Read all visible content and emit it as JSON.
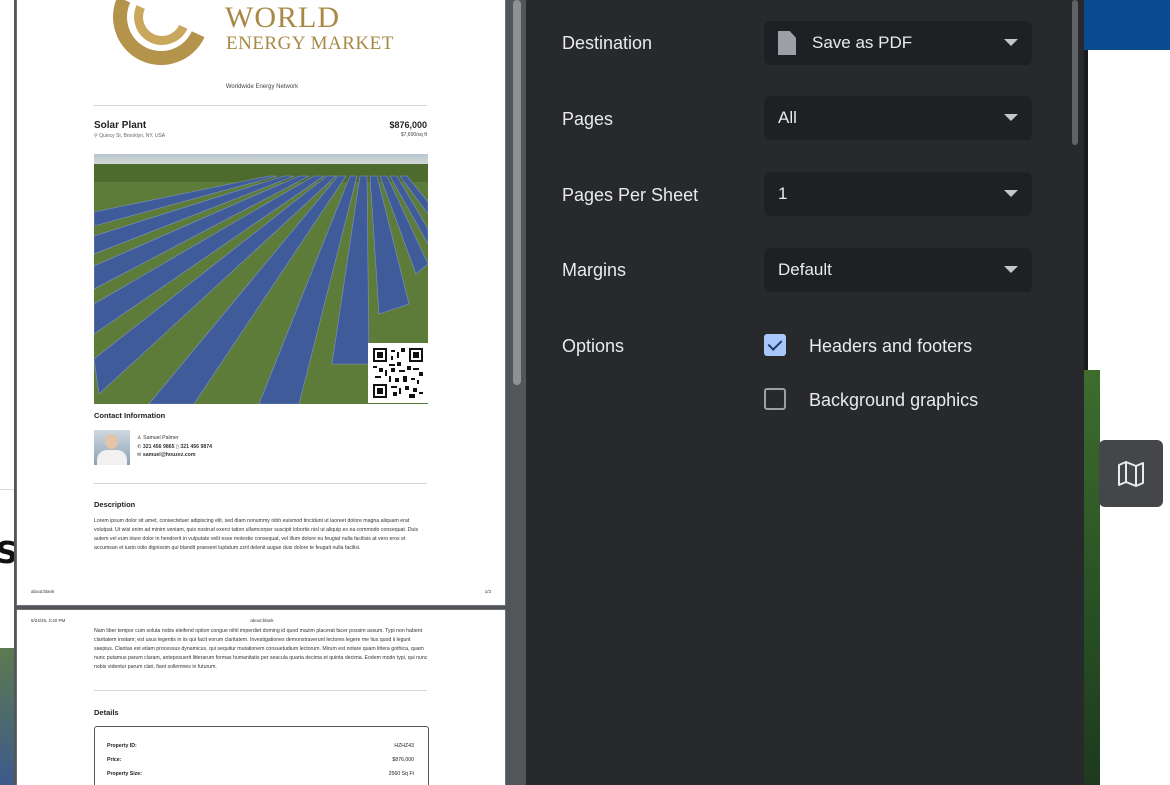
{
  "preview": {
    "page1": {
      "logo_line1": "WORLD",
      "logo_line2": "ENERGY MARKET",
      "tagline": "Worldwide Energy Network",
      "property_title": "Solar Plant",
      "property_address": "Quincy St, Brooklyn, NY, USA",
      "property_price": "$876,000",
      "property_price_per_sqft": "$7,600/sq ft",
      "contact_heading": "Contact Information",
      "agent_name": "Samuel Palmer",
      "agent_phone1": "321 456 9865",
      "agent_phone2": "321 456 9874",
      "agent_email": "samuel@houzez.com",
      "description_heading": "Description",
      "description_text": "Lorem ipsum dolor sit amet, consectetuer adipiscing elit, sed diam nonummy nibh euismod tincidunt ut laoreet dolore magna aliquam erat volutpat. Ut wisi enim ad minim veniam, quis nostrud exerci tation ullamcorper suscipit lobortis nisl ut aliquip ex ea commodo consequat. Duis autem vel eum iriure dolor in hendrerit in vulputate velit esse molestie consequat, vel illum dolore eu feugiat nulla facilisis at vero eros et accumsan et iusto odio dignissim qui blandit praesent luptatum zzril delenit augue duis dolore te feugait nulla facilisi.",
      "footer_left": "about:blank",
      "footer_right": "1/3"
    },
    "page2": {
      "header_left": "5/24/25, 2:40 PM",
      "header_center": "about:blank",
      "text": "Nam liber tempor cum soluta nobis eleifend option congue nihil imperdiet doming id quod mazim placerat facer possim assum. Typi non habent claritatem insitam; est usus legentis in iis qui facit eorum claritatem. Investigationes demonstraverunt lectores legere me lius quod ii legunt saepius. Claritas est etiam processus dynamicus, qui sequitur mutationem consuetudium lectorum. Mirum est notare quam littera gothica, quam nunc putamus parum claram, anteposuerit litterarum formas humanitatis per seacula quarta decima et quinta decima. Eodem modo typi, qui nunc nobis videntur parum clari, fiant sollemnes in futurum.",
      "details_heading": "Details",
      "details": [
        {
          "key": "Property ID:",
          "value": "HZHZ43"
        },
        {
          "key": "Price:",
          "value": "$876,000"
        },
        {
          "key": "Property Size:",
          "value": "2560 Sq Ft"
        }
      ]
    }
  },
  "print_settings": {
    "destination_label": "Destination",
    "destination_value": "Save as PDF",
    "pages_label": "Pages",
    "pages_value": "All",
    "pages_per_sheet_label": "Pages Per Sheet",
    "pages_per_sheet_value": "1",
    "margins_label": "Margins",
    "margins_value": "Default",
    "options_label": "Options",
    "headers_footers_label": "Headers and footers",
    "headers_footers_checked": true,
    "background_graphics_label": "Background graphics",
    "background_graphics_checked": false
  },
  "background_site": {
    "map_button_icon": "map-icon"
  },
  "colors": {
    "panel_bg": "#28292c",
    "select_bg": "#1f2023",
    "checkbox_on": "#a8c7fa",
    "logo_gold": "#a98845"
  }
}
